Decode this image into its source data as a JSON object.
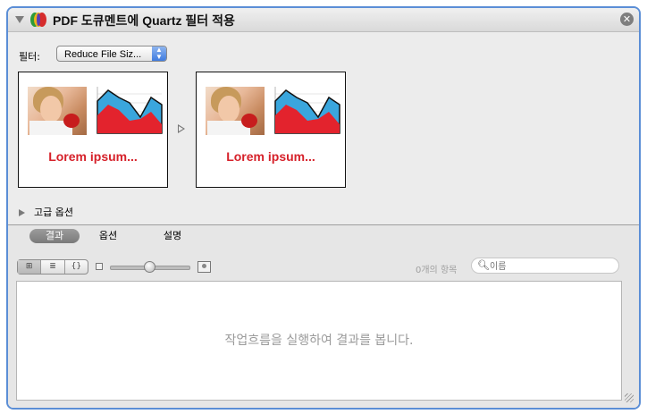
{
  "window": {
    "title_prefix": "PDF 도큐멘트에 ",
    "title_bold": "Quartz",
    "title_suffix": " 필터 적용",
    "close_symbol": "✕",
    "app_icon": "automator-action-icon"
  },
  "filter": {
    "label": "필터:",
    "selected": "Reduce File Siz..."
  },
  "preview": {
    "before_text": "Lorem ipsum...",
    "after_text": "Lorem ipsum...",
    "arrow_icon": "arrow-right-icon"
  },
  "advanced": {
    "label": "고급 옵션"
  },
  "tabs": [
    {
      "label": "결과",
      "selected": true
    },
    {
      "label": "옵션",
      "selected": false
    },
    {
      "label": "설명",
      "selected": false
    }
  ],
  "view_buttons": [
    {
      "symbol": "⊞",
      "icon": "grid-view-icon",
      "active": true
    },
    {
      "symbol": "≣",
      "icon": "list-view-icon",
      "active": false
    },
    {
      "symbol": "{}",
      "icon": "code-view-icon",
      "active": false
    }
  ],
  "results": {
    "count_text": "0개의 항목",
    "search_placeholder": "이름",
    "empty_message": "작업흐름을 실행하여 결과를 봅니다."
  },
  "colors": {
    "window_border": "#5b8ed6",
    "lorem_red": "#d6212a",
    "chart_blue": "#3aa6dd",
    "chart_red": "#e3232d"
  }
}
